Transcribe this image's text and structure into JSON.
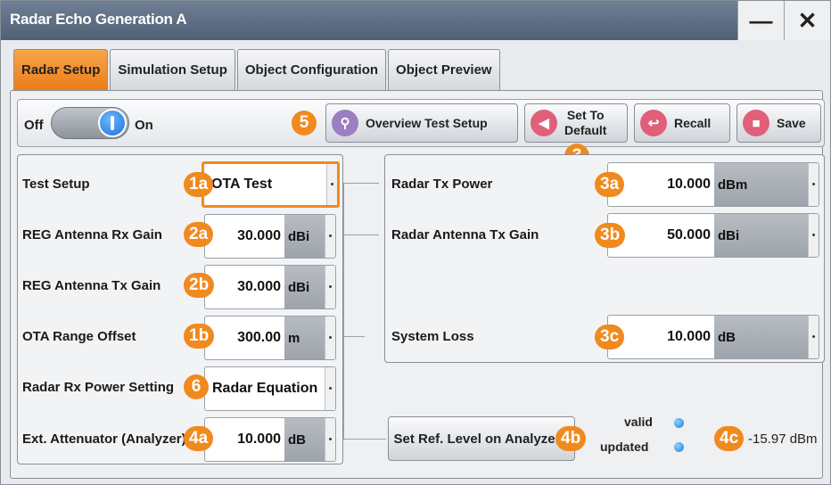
{
  "window": {
    "title": "Radar Echo Generation A",
    "minimize": "—",
    "close": "✕"
  },
  "tabs": [
    "Radar Setup",
    "Simulation Setup",
    "Object Configuration",
    "Object Preview"
  ],
  "toolbar": {
    "off": "Off",
    "on": "On",
    "toggle_state": "on",
    "overview": "Overview Test Setup",
    "default_line1": "Set To",
    "default_line2": "Default",
    "recall": "Recall",
    "save": "Save"
  },
  "badges": {
    "b5": "5",
    "b3": "3",
    "b1a": "1a",
    "b2a": "2a",
    "b2b": "2b",
    "b1b": "1b",
    "b6": "6",
    "b4a": "4a",
    "b3a": "3a",
    "b3b": "3b",
    "b3c": "3c",
    "b4b": "4b",
    "b4c": "4c"
  },
  "left": {
    "test_setup": {
      "label": "Test Setup",
      "value": "OTA Test"
    },
    "rx_gain": {
      "label": "REG Antenna Rx Gain",
      "value": "30.000",
      "unit": "dBi"
    },
    "tx_gain": {
      "label": "REG Antenna Tx Gain",
      "value": "30.000",
      "unit": "dBi"
    },
    "range_offset": {
      "label": "OTA Range Offset",
      "value": "300.00",
      "unit": "m"
    },
    "rx_power": {
      "label": "Radar Rx Power Setting",
      "value": "Radar Equation"
    },
    "attenuator": {
      "label": "Ext. Attenuator (Analyzer)",
      "value": "10.000",
      "unit": "dB"
    }
  },
  "right": {
    "tx_power": {
      "label": "Radar Tx Power",
      "value": "10.000",
      "unit": "dBm"
    },
    "ant_tx_gain": {
      "label": "Radar Antenna Tx Gain",
      "value": "50.000",
      "unit": "dBi"
    },
    "system_loss": {
      "label": "System Loss",
      "value": "10.000",
      "unit": "dB"
    }
  },
  "analyzer": {
    "button": "Set Ref. Level on Analyzer",
    "valid": "valid",
    "updated": "updated",
    "result": "-15.97 dBm"
  },
  "colors": {
    "accent": "#f08a1e",
    "titlebar": "#5b6b80"
  }
}
